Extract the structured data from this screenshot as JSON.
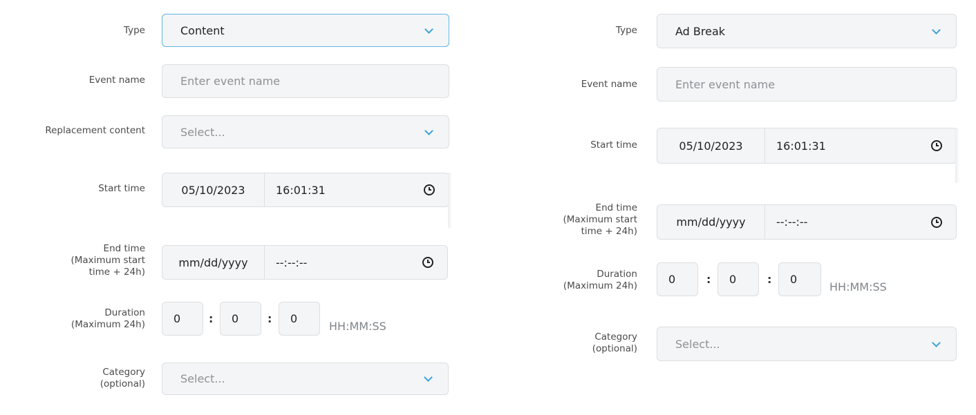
{
  "left_form": {
    "type_label": "Type",
    "type_value": "Content",
    "event_name_label": "Event name",
    "event_name_placeholder": "Enter event name",
    "replacement_label": "Replacement content",
    "replacement_value": "Select...",
    "start_label": "Start time",
    "start_date": "05/10/2023",
    "start_time": "16:01:31",
    "end_label_line1": "End time",
    "end_label_line2": "(Maximum start",
    "end_label_line3": "time + 24h)",
    "end_date": "mm/dd/yyyy",
    "end_time": "--:--:--",
    "duration_label_line1": "Duration",
    "duration_label_line2": "(Maximum 24h)",
    "duration_hh": "0",
    "duration_mm": "0",
    "duration_ss": "0",
    "duration_hint": "HH:MM:SS",
    "category_label_line1": "Category",
    "category_label_line2": "(optional)",
    "category_value": "Select..."
  },
  "right_form": {
    "type_label": "Type",
    "type_value": "Ad Break",
    "event_name_label": "Event name",
    "event_name_placeholder": "Enter event name",
    "start_label": "Start time",
    "start_date": "05/10/2023",
    "start_time": "16:01:31",
    "end_label_line1": "End time",
    "end_label_line2": "(Maximum start",
    "end_label_line3": "time + 24h)",
    "end_date": "mm/dd/yyyy",
    "end_time": "--:--:--",
    "duration_label_line1": "Duration",
    "duration_label_line2": "(Maximum 24h)",
    "duration_hh": "0",
    "duration_mm": "0",
    "duration_ss": "0",
    "duration_hint": "HH:MM:SS",
    "category_label_line1": "Category",
    "category_label_line2": "(optional)",
    "category_value": "Select..."
  },
  "colors": {
    "accent": "#3aa3dc",
    "focus_border": "#5fb6e4",
    "field_bg": "#f4f5f6",
    "field_border": "#dcdee1"
  },
  "icons": {
    "dropdown": "chevron-down-icon",
    "time": "clock-icon"
  }
}
